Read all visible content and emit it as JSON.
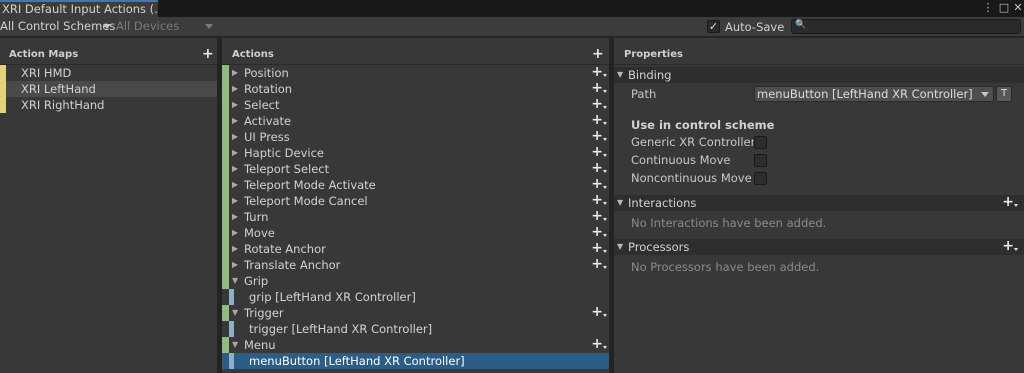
{
  "window": {
    "tab_title": "XRI Default Input Actions (...",
    "kebab_glyph": "⋮",
    "maximize_glyph": "□",
    "close_glyph": "✕"
  },
  "toolbar": {
    "control_schemes": "All Control Schemes",
    "devices": "All Devices",
    "autosave_checked_glyph": "✓",
    "autosave_label": "Auto-Save",
    "search_glyph": "🔍",
    "search_value": ""
  },
  "action_maps": {
    "header": "Action Maps",
    "add_glyph": "+",
    "items": [
      {
        "label": "XRI HMD"
      },
      {
        "label": "XRI LeftHand"
      },
      {
        "label": "XRI RightHand"
      }
    ]
  },
  "actions": {
    "header": "Actions",
    "add_glyph": "+",
    "collapsed_glyph": "▶",
    "expanded_glyph": "▼",
    "items": [
      {
        "label": "Position"
      },
      {
        "label": "Rotation"
      },
      {
        "label": "Select"
      },
      {
        "label": "Activate"
      },
      {
        "label": "UI Press"
      },
      {
        "label": "Haptic Device"
      },
      {
        "label": "Teleport Select"
      },
      {
        "label": "Teleport Mode Activate"
      },
      {
        "label": "Teleport Mode Cancel"
      },
      {
        "label": "Turn"
      },
      {
        "label": "Move"
      },
      {
        "label": "Rotate Anchor"
      },
      {
        "label": "Translate Anchor"
      },
      {
        "label": "Grip",
        "binding": "grip [LeftHand XR Controller]"
      },
      {
        "label": "Trigger",
        "binding": "trigger [LeftHand XR Controller]"
      },
      {
        "label": "Menu",
        "binding": "menuButton [LeftHand XR Controller]"
      }
    ]
  },
  "properties": {
    "header": "Properties",
    "binding": {
      "section_label": "Binding",
      "path_label": "Path",
      "path_value": "menuButton [LeftHand XR Controller]",
      "t_button": "T",
      "scheme_heading": "Use in control scheme",
      "schemes": [
        {
          "label": "Generic XR Controller"
        },
        {
          "label": "Continuous Move"
        },
        {
          "label": "Noncontinuous Move"
        }
      ]
    },
    "interactions": {
      "section_label": "Interactions",
      "empty": "No Interactions have been added."
    },
    "processors": {
      "section_label": "Processors",
      "empty": "No Processors have been added."
    },
    "add_glyph": "+",
    "expanded_glyph": "▼"
  },
  "colors": {
    "accent_tab": "#3a79bb",
    "action_map_marker": "#e3d27a",
    "action_marker": "#8fbc7e",
    "binding_marker": "#8eb0c6",
    "selected_row": "#2c5d87"
  }
}
